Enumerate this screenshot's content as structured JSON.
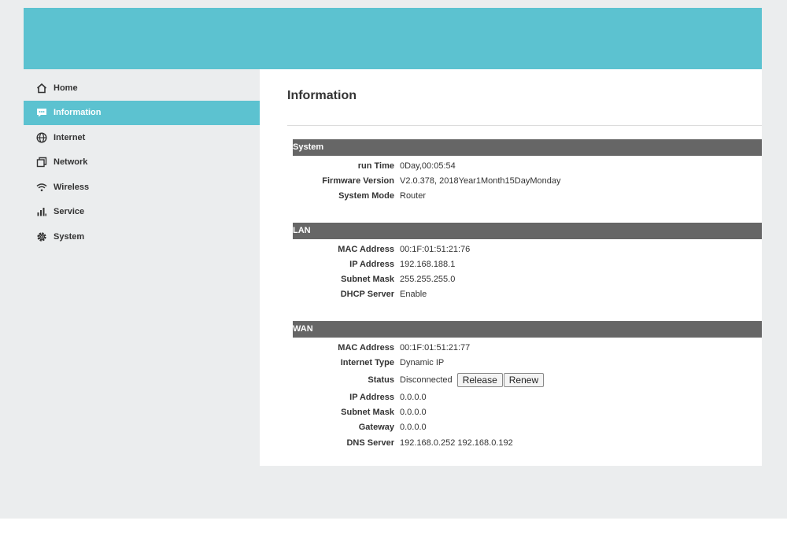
{
  "sidebar": {
    "items": [
      {
        "label": "Home",
        "icon": "home-icon"
      },
      {
        "label": "Information",
        "icon": "chat-icon"
      },
      {
        "label": "Internet",
        "icon": "globe-icon"
      },
      {
        "label": "Network",
        "icon": "network-icon"
      },
      {
        "label": "Wireless",
        "icon": "wifi-icon"
      },
      {
        "label": "Service",
        "icon": "bar-chart-icon"
      },
      {
        "label": "System",
        "icon": "gear-icon"
      }
    ],
    "active": "Information"
  },
  "main": {
    "title": "Information",
    "system": {
      "heading": "System",
      "rows": [
        {
          "label": "run Time",
          "value": "0Day,00:05:54"
        },
        {
          "label": "Firmware Version",
          "value": "V2.0.378,  2018Year1Month15DayMonday"
        },
        {
          "label": "System Mode",
          "value": "Router"
        }
      ]
    },
    "lan": {
      "heading": "LAN",
      "rows": [
        {
          "label": "MAC Address",
          "value": "00:1F:01:51:21:76"
        },
        {
          "label": "IP Address",
          "value": "192.168.188.1"
        },
        {
          "label": "Subnet Mask",
          "value": "255.255.255.0"
        },
        {
          "label": "DHCP Server",
          "value": "Enable"
        }
      ]
    },
    "wan": {
      "heading": "WAN",
      "rows": [
        {
          "label": "MAC Address",
          "value": "00:1F:01:51:21:77"
        },
        {
          "label": "Internet Type",
          "value": "Dynamic IP"
        },
        {
          "label": "Status",
          "value": "Disconnected"
        },
        {
          "label": "IP Address",
          "value": "0.0.0.0"
        },
        {
          "label": "Subnet Mask",
          "value": "0.0.0.0"
        },
        {
          "label": "Gateway",
          "value": "0.0.0.0"
        },
        {
          "label": "DNS Server",
          "value": "192.168.0.252 192.168.0.192"
        }
      ],
      "release_label": "Release",
      "renew_label": "Renew"
    }
  },
  "colors": {
    "accent": "#5cc2d0",
    "section_header": "#666666",
    "page_background": "#ebedee"
  }
}
